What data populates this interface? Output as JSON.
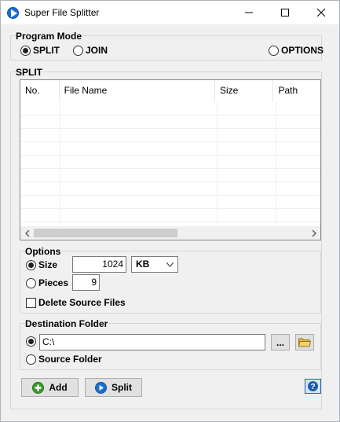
{
  "window": {
    "title": "Super File Splitter"
  },
  "program_mode": {
    "title": "Program Mode",
    "split_label": "SPLIT",
    "join_label": "JOIN",
    "options_label": "OPTIONS",
    "selected": "SPLIT"
  },
  "split_section": {
    "title": "SPLIT",
    "columns": [
      "No.",
      "File Name",
      "Size",
      "Path"
    ]
  },
  "options": {
    "title": "Options",
    "size_label": "Size",
    "size_value": "1024",
    "unit_value": "KB",
    "pieces_label": "Pieces",
    "pieces_value": "9",
    "delete_label": "Delete Source Files",
    "delete_checked": false,
    "mode_selected": "Size"
  },
  "destination": {
    "title": "Destination Folder",
    "path_value": "C:\\",
    "browse_label": "...",
    "source_folder_label": "Source Folder",
    "selected": "path"
  },
  "buttons": {
    "add_label": "Add",
    "split_label": "Split"
  },
  "icons": [
    "app-icon",
    "minimize-icon",
    "maximize-icon",
    "close-icon",
    "folder-icon",
    "add-icon",
    "play-icon",
    "help-icon"
  ],
  "colors": {
    "accent": "#1c6fd0",
    "add_green": "#3a9c2d",
    "folder_yellow": "#f2c24f"
  }
}
